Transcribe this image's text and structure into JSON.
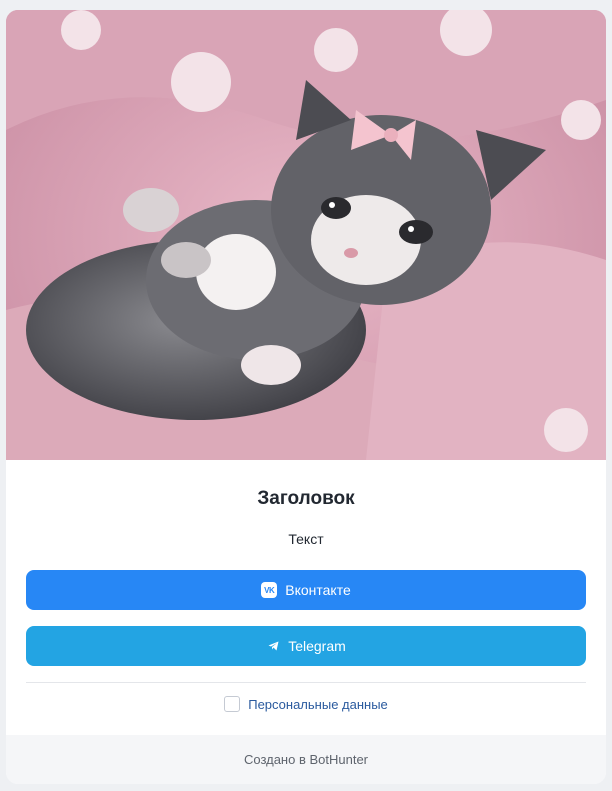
{
  "hero": {
    "image_subject": "kitten-photo"
  },
  "content": {
    "title": "Заголовок",
    "text": "Текст"
  },
  "buttons": {
    "vk_label": "Вконтакте",
    "vk_icon_text": "VK",
    "telegram_label": "Telegram"
  },
  "consent": {
    "label": "Персональные данные",
    "checked": false
  },
  "footer": {
    "text": "Создано в BotHunter"
  },
  "colors": {
    "vk_button": "#2787f5",
    "telegram_button": "#23a4e3",
    "link": "#2a5a9e",
    "background": "#eef0f3"
  },
  "icons": {
    "vk": "vk-logo-icon",
    "telegram": "telegram-plane-icon"
  }
}
